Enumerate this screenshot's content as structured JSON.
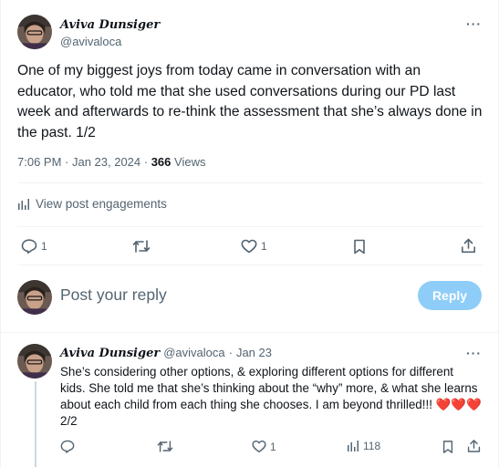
{
  "tweet": {
    "author_name": "Aviva Dunsiger",
    "author_handle": "@avivaloca",
    "more_label": "···",
    "text": "One of my biggest joys from today came in conversation with an educator, who told me that she used conversations during our PD last week and afterwards to re-think the assessment that she’s always done in the past. 1/2",
    "time": "7:06 PM · Jan 23, 2024 · ",
    "views_count": "366",
    "views_label": " Views",
    "engagements_label": "View post engagements",
    "actions": {
      "reply_count": "1",
      "retweet_count": "",
      "like_count": "1"
    }
  },
  "composer": {
    "placeholder": "Post your reply",
    "reply_button": "Reply"
  },
  "reply_tweet": {
    "author_name": "Aviva Dunsiger",
    "author_handle": "@avivaloca",
    "separator": "·",
    "date": "Jan 23",
    "more_label": "···",
    "text_line1": "She’s considering other options, & exploring different options for different kids. She told me that she’s thinking about the “why” more, & what she learns about each child from each thing she chooses. I am beyond thrilled!!! ",
    "hearts": "❤️❤️❤️",
    "text_suffix": " 2/2",
    "actions": {
      "like_count": "1",
      "views_count": "118"
    }
  },
  "colors": {
    "accent_disabled": "#8ecdf8",
    "text_primary": "#0f1419",
    "text_secondary": "#536471",
    "divider": "#eff3f4"
  }
}
